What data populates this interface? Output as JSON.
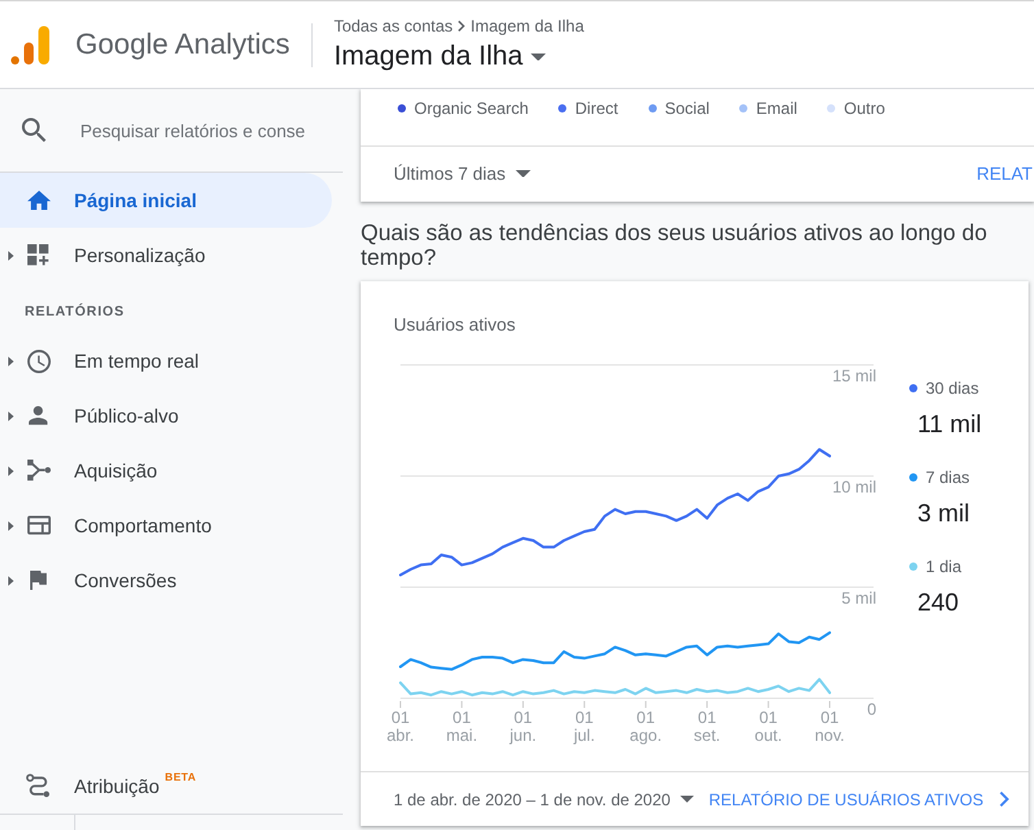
{
  "header": {
    "product": "Google Analytics",
    "breadcrumb": [
      "Todas as contas",
      "Imagem da Ilha"
    ],
    "property": "Imagem da Ilha"
  },
  "sidebar": {
    "search": {
      "placeholder": "Pesquisar relatórios e conse"
    },
    "items": [
      {
        "label": "Página inicial",
        "kind": "page",
        "selected": true
      },
      {
        "label": "Personalização",
        "kind": "group",
        "selected": false,
        "expanded": false
      }
    ],
    "section": {
      "title": "RELATÓRIOS",
      "items": [
        {
          "label": "Em tempo real",
          "kind": "group",
          "selected": false,
          "expanded": false
        },
        {
          "label": "Público-alvo",
          "kind": "group",
          "selected": false,
          "expanded": false
        },
        {
          "label": "Aquisição",
          "kind": "group",
          "selected": false,
          "expanded": false
        },
        {
          "label": "Comportamento",
          "kind": "group",
          "selected": false,
          "expanded": false
        },
        {
          "label": "Conversões",
          "kind": "group",
          "selected": false,
          "expanded": false
        }
      ]
    },
    "footer_item": {
      "label": "Atribuição",
      "badge": "BETA",
      "selected": false
    }
  },
  "traffic_card": {
    "legend": [
      {
        "label": "Organic Search",
        "color": "#3a4fd6"
      },
      {
        "label": "Direct",
        "color": "#4a6ef0"
      },
      {
        "label": "Social",
        "color": "#6e9bf2"
      },
      {
        "label": "Email",
        "color": "#a4c2f8"
      },
      {
        "label": "Outro",
        "color": "#d5e1fb"
      }
    ],
    "date_range": "Últimos 7 dias",
    "link": "RELAT"
  },
  "question": "Quais são as tendências dos seus usuários ativos ao longo do tempo?",
  "active_users_card": {
    "title": "Usuários ativos",
    "chart_data": {
      "type": "line",
      "legend": "right",
      "categories": [
        "01 abr.",
        null,
        null,
        null,
        null,
        null,
        "01 mai.",
        null,
        null,
        null,
        null,
        null,
        "01 jun.",
        null,
        null,
        null,
        null,
        null,
        "01 jul.",
        null,
        null,
        null,
        null,
        null,
        "01 ago.",
        null,
        null,
        null,
        null,
        null,
        "01 set.",
        null,
        null,
        null,
        null,
        null,
        "01 out.",
        null,
        null,
        null,
        null,
        null,
        "01 nov."
      ],
      "ylim": [
        0,
        15
      ],
      "yticks": [
        {
          "value": 0,
          "label": "0"
        },
        {
          "value": 5,
          "label": "5 mil"
        },
        {
          "value": 10,
          "label": "10 mil"
        },
        {
          "value": 15,
          "label": "15 mil"
        }
      ],
      "series": [
        {
          "name": "30 dias",
          "color": "#3f6ff2",
          "values": [
            5.55,
            5.8,
            6.0,
            6.05,
            6.45,
            6.35,
            6.0,
            6.1,
            6.3,
            6.5,
            6.8,
            7.0,
            7.2,
            7.1,
            6.8,
            6.8,
            7.1,
            7.3,
            7.5,
            7.6,
            8.2,
            8.5,
            8.3,
            8.4,
            8.4,
            8.3,
            8.2,
            8.0,
            8.2,
            8.5,
            8.1,
            8.7,
            9.0,
            9.2,
            8.9,
            9.3,
            9.5,
            10.0,
            10.1,
            10.3,
            10.7,
            11.2,
            10.9
          ]
        },
        {
          "name": "7 dias",
          "color": "#2196f3",
          "values": [
            1.42,
            1.75,
            1.6,
            1.4,
            1.35,
            1.3,
            1.5,
            1.75,
            1.85,
            1.85,
            1.8,
            1.6,
            1.75,
            1.7,
            1.6,
            1.6,
            2.1,
            1.85,
            1.8,
            1.9,
            2.0,
            2.3,
            2.15,
            1.95,
            2.0,
            1.95,
            1.9,
            2.1,
            2.3,
            2.35,
            1.95,
            2.3,
            2.35,
            2.3,
            2.35,
            2.4,
            2.45,
            2.9,
            2.55,
            2.5,
            2.75,
            2.65,
            2.95
          ]
        },
        {
          "name": "1 dia",
          "color": "#7dd3f0",
          "values": [
            0.7,
            0.2,
            0.25,
            0.15,
            0.3,
            0.2,
            0.3,
            0.15,
            0.25,
            0.2,
            0.3,
            0.15,
            0.3,
            0.2,
            0.25,
            0.35,
            0.2,
            0.3,
            0.25,
            0.35,
            0.3,
            0.25,
            0.4,
            0.2,
            0.45,
            0.25,
            0.3,
            0.35,
            0.25,
            0.4,
            0.3,
            0.35,
            0.25,
            0.3,
            0.45,
            0.3,
            0.4,
            0.55,
            0.3,
            0.45,
            0.35,
            0.85,
            0.25
          ]
        }
      ]
    },
    "totals": [
      "11 mil",
      "3 mil",
      "240"
    ],
    "date_range": "1 de abr. de 2020 – 1 de nov. de 2020",
    "link": "RELATÓRIO DE USUÁRIOS ATIVOS"
  }
}
